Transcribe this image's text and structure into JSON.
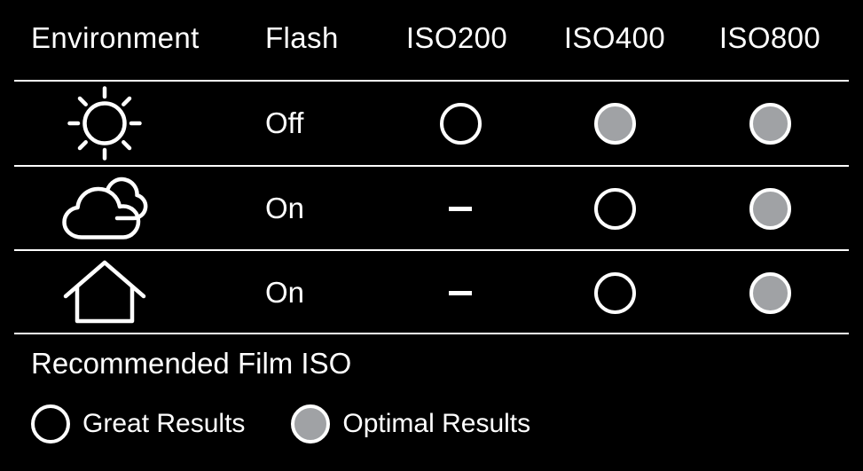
{
  "table": {
    "columns": [
      {
        "key": "environment",
        "label": "Environment"
      },
      {
        "key": "flash",
        "label": "Flash"
      },
      {
        "key": "iso200",
        "label": "ISO200"
      },
      {
        "key": "iso400",
        "label": "ISO400"
      },
      {
        "key": "iso800",
        "label": "ISO800"
      }
    ],
    "rows": [
      {
        "environment_icon": "sun-icon",
        "environment_name": "Sunny",
        "flash": "Off",
        "iso200": "open-circle",
        "iso400": "filled-circle",
        "iso800": "filled-circle"
      },
      {
        "environment_icon": "cloud-icon",
        "environment_name": "Cloudy",
        "flash": "On",
        "iso200": "dash",
        "iso400": "open-circle",
        "iso800": "filled-circle"
      },
      {
        "environment_icon": "house-icon",
        "environment_name": "Indoor",
        "flash": "On",
        "iso200": "dash",
        "iso400": "open-circle",
        "iso800": "filled-circle"
      }
    ]
  },
  "footer": {
    "title": "Recommended Film ISO",
    "legend": [
      {
        "marker": "open-circle",
        "label": "Great Results"
      },
      {
        "marker": "filled-circle",
        "label": "Optimal Results"
      }
    ]
  },
  "colors": {
    "background": "#000000",
    "foreground": "#ffffff",
    "marker_fill": "#a0a2a5"
  }
}
